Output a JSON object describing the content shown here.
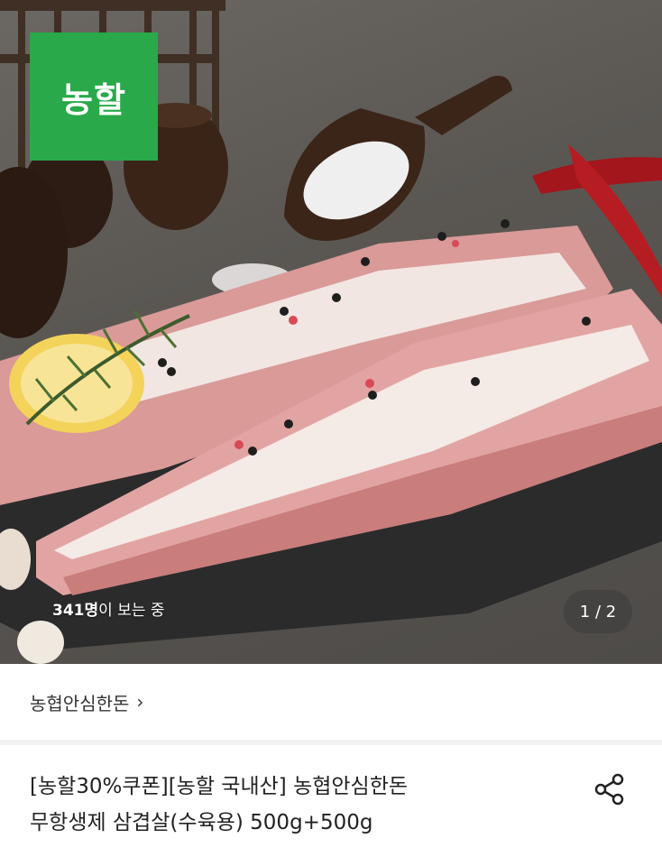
{
  "hero": {
    "logo_text": "농할",
    "logo_color": "#29a949",
    "viewers_count": "341명",
    "viewers_suffix": "이 보는 중",
    "pager": "1 / 2"
  },
  "store": {
    "name": "농협안심한돈",
    "chevron": "›"
  },
  "product": {
    "title_line1": "[농할30%쿠폰][농할 국내산] 농협안심한돈",
    "title_line2": "무항생제 삼겹살(수육용) 500g+500g"
  },
  "icons": {
    "share": "share-icon"
  }
}
